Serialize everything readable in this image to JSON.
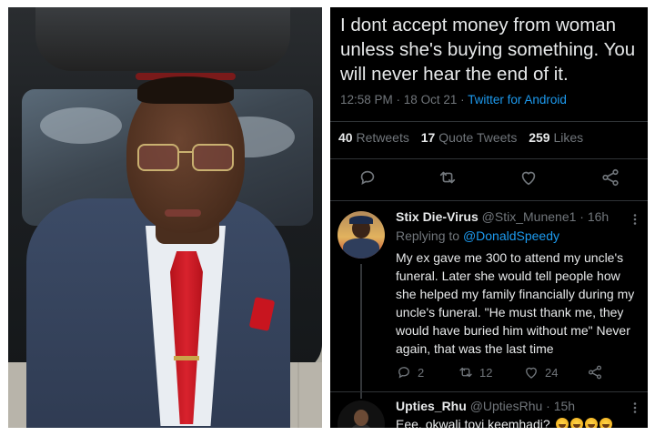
{
  "tweet": {
    "text": "I dont accept money from woman unless she's buying something. You will never hear the end of it.",
    "time": "12:58 PM",
    "date": "18 Oct 21",
    "separator": " · ",
    "source": "Twitter for Android",
    "retweets_count": "40",
    "retweets_label": "Retweets",
    "quotes_count": "17",
    "quotes_label": "Quote Tweets",
    "likes_count": "259",
    "likes_label": "Likes"
  },
  "reply": {
    "name": "Stix Die-Virus",
    "handle": "@Stix_Munene1",
    "time": " · 16h",
    "replying_prefix": "Replying to ",
    "replying_to": "@DonaldSpeedy",
    "text": "My ex gave me 300 to attend my uncle's funeral. Later she would tell people how she helped my family financially during my uncle's funeral. \"He must thank me, they would have buried him without me\" Never again, that was the last time",
    "replies": "2",
    "retweets": "12",
    "likes": "24"
  },
  "reply2": {
    "name": "Upties_Rhu",
    "handle": "@UptiesRhu",
    "time": " · 15h",
    "text": "Eee, okwali toyi keemhadi?"
  },
  "icons": {
    "reply": "reply-icon",
    "retweet": "retweet-icon",
    "like": "heart-icon",
    "share": "share-icon",
    "more": "more-icon",
    "emoji": "laughing-emoji-icon"
  },
  "colors": {
    "background": "#000000",
    "text": "#e7e9ea",
    "secondary": "#71767b",
    "accent": "#1d9bf0"
  }
}
